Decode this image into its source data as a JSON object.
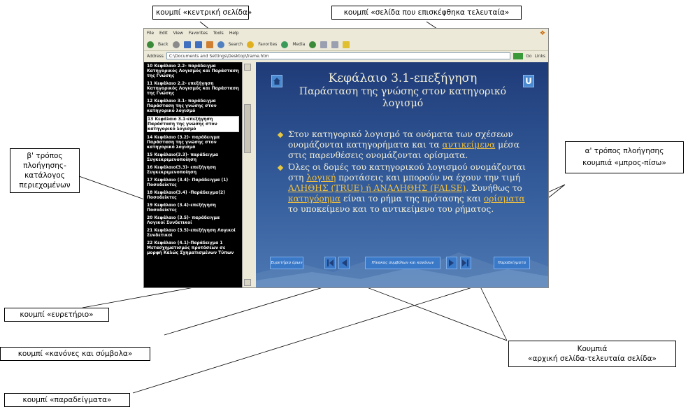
{
  "callouts": {
    "home_button": "κουμπί «κεντρική σελίδα»",
    "last_visited": "κουμπί «σελίδα που επισκέφθηκα τελευταία»",
    "toc_nav": [
      "β' τρόπος",
      "πλοήγησης-",
      "κατάλογος",
      "περιεχομένων"
    ],
    "back_forward": [
      "α' τρόπος πλοήγησης",
      "κουμπιά «μπρος-πίσω»"
    ],
    "index": "κουμπί «ευρετήριο»",
    "rules": "κουμπί «κανόνες και σύμβολα»",
    "first_last": [
      "Κουμπιά",
      "«αρχική σελίδα-τελευταία σελίδα»"
    ],
    "examples": "κουμπί «παραδείγματα»"
  },
  "browser": {
    "menu": [
      "File",
      "Edit",
      "View",
      "Favorites",
      "Tools",
      "Help"
    ],
    "toolbar": [
      "Back",
      "Search",
      "Favorites",
      "Media"
    ],
    "address_label": "Address",
    "address": "C:\\Documents and Settings\\Desktop\\frame.htm",
    "go": "Go",
    "links": "Links"
  },
  "toc": [
    {
      "text": "10 Κεφάλαιο 2.2- παράδειγμα Κατηγορικός Λογισμός και Παράσταση της Γνώσης"
    },
    {
      "text": "11 Κεφάλαιο 2.2- επεξήγηση Κατηγορικός Λογισμός και Παράσταση της Γνώσης"
    },
    {
      "text": "12 Κεφάλαιο 3.1- παράδειγμα Παράσταση της γνώσης στον κατηγορικό λογισμό"
    },
    {
      "text": "13 Κεφάλαιο 3.1-επεξήγηση Παράσταση της γνώσης στον κατηγορικό λογισμό",
      "selected": true
    },
    {
      "text": "14 Κεφάλαιο (3.2)- παράδειγμα Παράσταση της γνώσης στον κατηγορικό λογισμό"
    },
    {
      "text": "15 Κεφάλαιο(3.3)- παράδειγμα Συγκεκριμενοποίηση"
    },
    {
      "text": "16 Κεφάλαιο(3.3)- επεξήγηση Συγκεκριμενοποίηση"
    },
    {
      "text": "17 Κεφάλαιο (3.4)- Παράδειγμα (1) Ποσοδείκτες"
    },
    {
      "text": "18 Κεφάλαιο(3.4) -Παράδειγμα(2) Ποσοδείκτες"
    },
    {
      "text": "19 Κεφάλαιο (3.4)-επεξήγηση Ποσοδείκτες"
    },
    {
      "text": "20 Κεφάλαιο (3.5)- παράδειγμα Λογικοί Συνδετικοί"
    },
    {
      "text": "21 Κεφάλαιο (3.5)-επεξήγηση Λογικοί Συνδετικοί"
    },
    {
      "text": "22 Κεφάλαιο (4.1)-Παράδειγμα 1 Μετασχηματισμός προτάσεων σε μορφή Καλώς Σχηματισμένων Τύπων"
    }
  ],
  "slide": {
    "title": "Κεφάλαιο 3.1-επεξήγηση",
    "subtitle": "Παράσταση της γνώσης στον κατηγορικό λογισμό",
    "last_icon": "U",
    "bullet1": {
      "a": "Στον κατηγορικό λογισμό τα ονόματα των σχέσεων ονομάζονται κατηγορήματα και τα ",
      "link": "αντικείμενα",
      "b": " μέσα στις παρενθέσεις ονομάζονται ορίσματα."
    },
    "bullet2": {
      "a": "Όλες οι δομές του κατηγορικού λογισμού ονομάζονται στη ",
      "link1": "λογική",
      "b": " προτάσεις και μπορούν να έχουν την τιμή ",
      "link2": "ΑΛΗΘΗΣ (TRUE) ή ΑΝΑΛΗΘΗΣ (FALSE)",
      "c": ". Συνήθως το ",
      "link3": "κατηγόρημα",
      "d": " είναι το ρήμα της πρότασης και ",
      "link4": "ορίσματα",
      "e": " το υποκείμενο και το αντικείμενο του ρήματος."
    },
    "nav": {
      "index": "Ευρετήριο όρων",
      "rules": "Πίνακας συμβόλων και κανόνων",
      "examples": "Παραδείγματα"
    }
  }
}
